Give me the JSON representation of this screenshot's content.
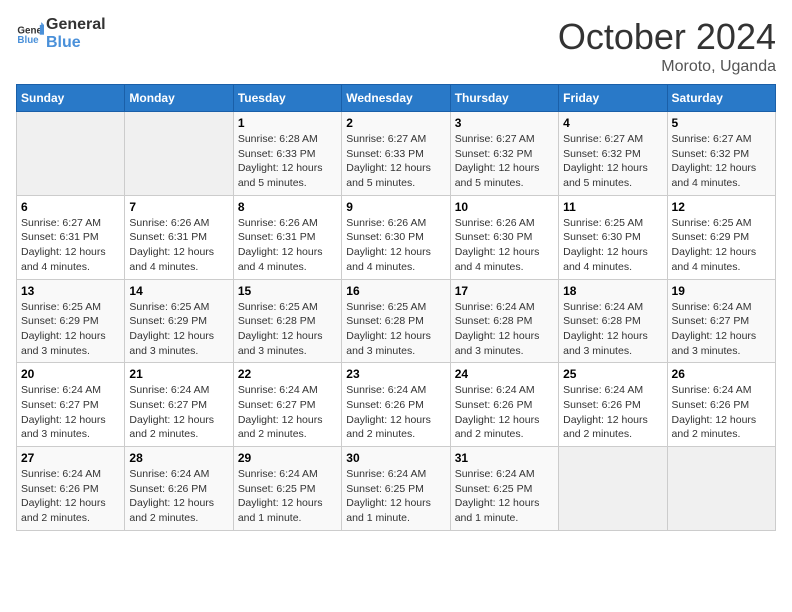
{
  "logo": {
    "line1": "General",
    "line2": "Blue"
  },
  "title": "October 2024",
  "location": "Moroto, Uganda",
  "days_of_week": [
    "Sunday",
    "Monday",
    "Tuesday",
    "Wednesday",
    "Thursday",
    "Friday",
    "Saturday"
  ],
  "weeks": [
    [
      {
        "day": "",
        "info": ""
      },
      {
        "day": "",
        "info": ""
      },
      {
        "day": "1",
        "info": "Sunrise: 6:28 AM\nSunset: 6:33 PM\nDaylight: 12 hours\nand 5 minutes."
      },
      {
        "day": "2",
        "info": "Sunrise: 6:27 AM\nSunset: 6:33 PM\nDaylight: 12 hours\nand 5 minutes."
      },
      {
        "day": "3",
        "info": "Sunrise: 6:27 AM\nSunset: 6:32 PM\nDaylight: 12 hours\nand 5 minutes."
      },
      {
        "day": "4",
        "info": "Sunrise: 6:27 AM\nSunset: 6:32 PM\nDaylight: 12 hours\nand 5 minutes."
      },
      {
        "day": "5",
        "info": "Sunrise: 6:27 AM\nSunset: 6:32 PM\nDaylight: 12 hours\nand 4 minutes."
      }
    ],
    [
      {
        "day": "6",
        "info": "Sunrise: 6:27 AM\nSunset: 6:31 PM\nDaylight: 12 hours\nand 4 minutes."
      },
      {
        "day": "7",
        "info": "Sunrise: 6:26 AM\nSunset: 6:31 PM\nDaylight: 12 hours\nand 4 minutes."
      },
      {
        "day": "8",
        "info": "Sunrise: 6:26 AM\nSunset: 6:31 PM\nDaylight: 12 hours\nand 4 minutes."
      },
      {
        "day": "9",
        "info": "Sunrise: 6:26 AM\nSunset: 6:30 PM\nDaylight: 12 hours\nand 4 minutes."
      },
      {
        "day": "10",
        "info": "Sunrise: 6:26 AM\nSunset: 6:30 PM\nDaylight: 12 hours\nand 4 minutes."
      },
      {
        "day": "11",
        "info": "Sunrise: 6:25 AM\nSunset: 6:30 PM\nDaylight: 12 hours\nand 4 minutes."
      },
      {
        "day": "12",
        "info": "Sunrise: 6:25 AM\nSunset: 6:29 PM\nDaylight: 12 hours\nand 4 minutes."
      }
    ],
    [
      {
        "day": "13",
        "info": "Sunrise: 6:25 AM\nSunset: 6:29 PM\nDaylight: 12 hours\nand 3 minutes."
      },
      {
        "day": "14",
        "info": "Sunrise: 6:25 AM\nSunset: 6:29 PM\nDaylight: 12 hours\nand 3 minutes."
      },
      {
        "day": "15",
        "info": "Sunrise: 6:25 AM\nSunset: 6:28 PM\nDaylight: 12 hours\nand 3 minutes."
      },
      {
        "day": "16",
        "info": "Sunrise: 6:25 AM\nSunset: 6:28 PM\nDaylight: 12 hours\nand 3 minutes."
      },
      {
        "day": "17",
        "info": "Sunrise: 6:24 AM\nSunset: 6:28 PM\nDaylight: 12 hours\nand 3 minutes."
      },
      {
        "day": "18",
        "info": "Sunrise: 6:24 AM\nSunset: 6:28 PM\nDaylight: 12 hours\nand 3 minutes."
      },
      {
        "day": "19",
        "info": "Sunrise: 6:24 AM\nSunset: 6:27 PM\nDaylight: 12 hours\nand 3 minutes."
      }
    ],
    [
      {
        "day": "20",
        "info": "Sunrise: 6:24 AM\nSunset: 6:27 PM\nDaylight: 12 hours\nand 3 minutes."
      },
      {
        "day": "21",
        "info": "Sunrise: 6:24 AM\nSunset: 6:27 PM\nDaylight: 12 hours\nand 2 minutes."
      },
      {
        "day": "22",
        "info": "Sunrise: 6:24 AM\nSunset: 6:27 PM\nDaylight: 12 hours\nand 2 minutes."
      },
      {
        "day": "23",
        "info": "Sunrise: 6:24 AM\nSunset: 6:26 PM\nDaylight: 12 hours\nand 2 minutes."
      },
      {
        "day": "24",
        "info": "Sunrise: 6:24 AM\nSunset: 6:26 PM\nDaylight: 12 hours\nand 2 minutes."
      },
      {
        "day": "25",
        "info": "Sunrise: 6:24 AM\nSunset: 6:26 PM\nDaylight: 12 hours\nand 2 minutes."
      },
      {
        "day": "26",
        "info": "Sunrise: 6:24 AM\nSunset: 6:26 PM\nDaylight: 12 hours\nand 2 minutes."
      }
    ],
    [
      {
        "day": "27",
        "info": "Sunrise: 6:24 AM\nSunset: 6:26 PM\nDaylight: 12 hours\nand 2 minutes."
      },
      {
        "day": "28",
        "info": "Sunrise: 6:24 AM\nSunset: 6:26 PM\nDaylight: 12 hours\nand 2 minutes."
      },
      {
        "day": "29",
        "info": "Sunrise: 6:24 AM\nSunset: 6:25 PM\nDaylight: 12 hours\nand 1 minute."
      },
      {
        "day": "30",
        "info": "Sunrise: 6:24 AM\nSunset: 6:25 PM\nDaylight: 12 hours\nand 1 minute."
      },
      {
        "day": "31",
        "info": "Sunrise: 6:24 AM\nSunset: 6:25 PM\nDaylight: 12 hours\nand 1 minute."
      },
      {
        "day": "",
        "info": ""
      },
      {
        "day": "",
        "info": ""
      }
    ]
  ]
}
